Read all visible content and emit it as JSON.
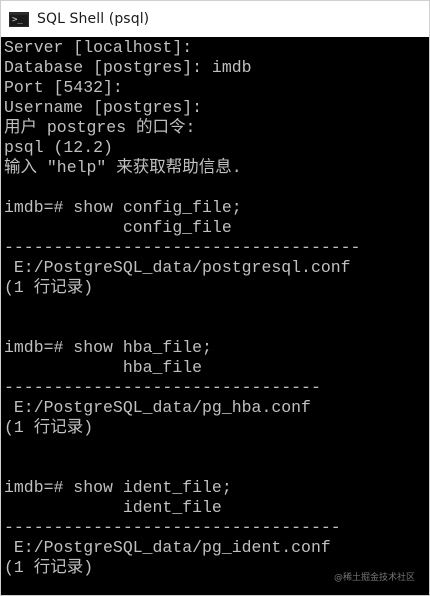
{
  "window": {
    "title": "SQL Shell (psql)",
    "icon": "console-app-icon"
  },
  "console": {
    "foreground": "#c0c0c0",
    "background": "#000000",
    "lines": [
      "Server [localhost]:",
      "Database [postgres]: imdb",
      "Port [5432]:",
      "Username [postgres]:",
      "用户 postgres 的口令:",
      "psql (12.2)",
      "输入 \"help\" 来获取帮助信息.",
      "",
      "imdb=# show config_file;",
      "            config_file",
      "------------------------------------",
      " E:/PostgreSQL_data/postgresql.conf",
      "(1 行记录)",
      "",
      "",
      "imdb=# show hba_file;",
      "            hba_file",
      "--------------------------------",
      " E:/PostgreSQL_data/pg_hba.conf",
      "(1 行记录)",
      "",
      "",
      "imdb=# show ident_file;",
      "            ident_file",
      "----------------------------------",
      " E:/PostgreSQL_data/pg_ident.conf",
      "(1 行记录)"
    ]
  },
  "watermark": "@稀土掘金技术社区"
}
